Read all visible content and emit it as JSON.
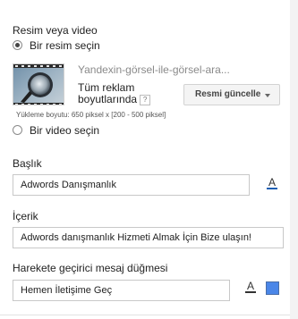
{
  "media": {
    "section_label": "Resim veya video",
    "option_image_label": "Bir resim seçin",
    "option_video_label": "Bir video seçin",
    "option_image_selected": true,
    "file_name": "Yandexin-görsel-ile-görsel-ara...",
    "adjust_line1": "Tüm reklam",
    "adjust_line2": "boyutlarında",
    "help_icon": "?",
    "update_button_label": "Resmi güncelle",
    "upload_hint": "Yükleme boyutu: 650 piksel x [200 - 500 piksel]"
  },
  "title_field": {
    "label": "Başlık",
    "value": "Adwords Danışmanlık",
    "font_color_glyph": "A",
    "font_color": "#1a5fb4"
  },
  "content_field": {
    "label": "İçerik",
    "value": "Adwords danışmanlık Hizmeti Almak İçin Bize ulaşın!"
  },
  "cta_field": {
    "label": "Harekete geçirici mesaj düğmesi",
    "value": "Hemen İletişime Geç",
    "font_color_glyph": "A",
    "font_color": "#333333",
    "button_color": "#4a86e8"
  }
}
